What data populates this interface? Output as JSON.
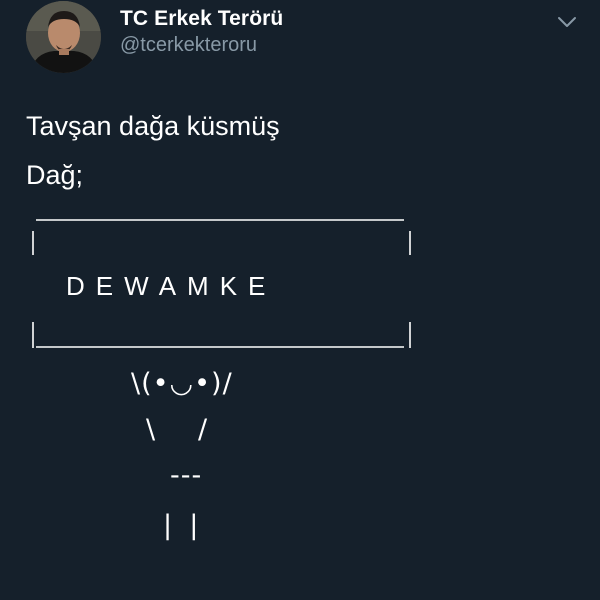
{
  "author": {
    "display_name": "TC Erkek Terörü",
    "handle": "@tcerkekteroru"
  },
  "icons": {
    "avatar": "profile-photo",
    "menu": "chevron-down-icon"
  },
  "tweet": {
    "lines": [
      "Tavşan dağa küsmüş",
      "Dağ;"
    ],
    "sign_text": "DEWAMKE",
    "bunny": {
      "face": "\\(•◡•)/",
      "arms": "\\     /",
      "body": "---",
      "legs": "|  |"
    }
  },
  "colors": {
    "background": "#15202b",
    "text": "#ffffff",
    "secondary_text": "#8899a6"
  }
}
